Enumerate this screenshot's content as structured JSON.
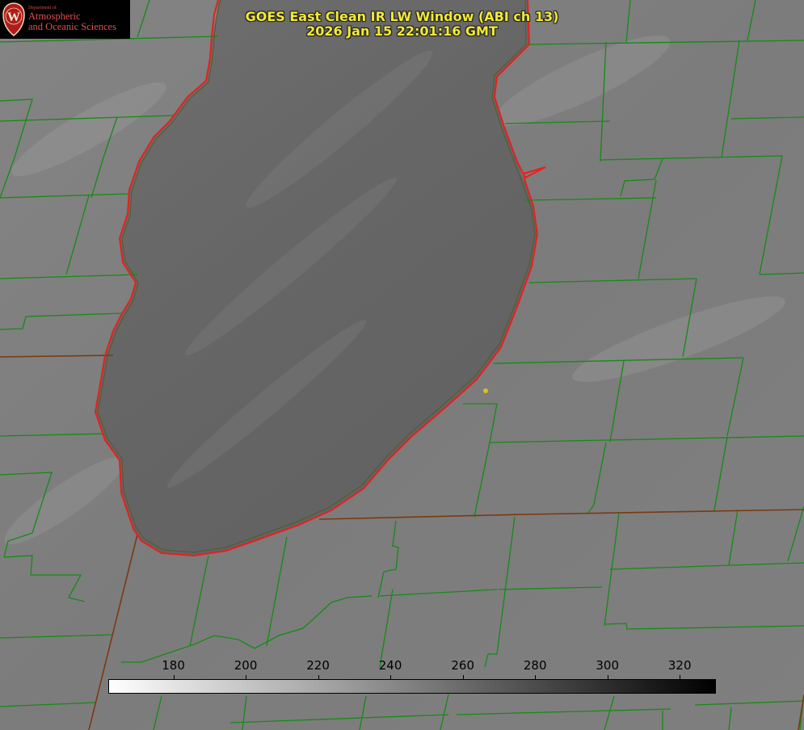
{
  "title": {
    "line1": "GOES East Clean IR LW Window (ABI ch 13)",
    "line2": "2026 Jan 15 22:01:16 GMT"
  },
  "logo": {
    "dept": "Department of",
    "line1": "Atmospheric",
    "line2": "and Oceanic Sciences",
    "seal_letter": "W"
  },
  "colorbar": {
    "ticks": [
      "180",
      "200",
      "220",
      "240",
      "260",
      "280",
      "300",
      "320"
    ],
    "tick_values": [
      180,
      200,
      220,
      240,
      260,
      280,
      300,
      320
    ],
    "range": [
      162,
      330
    ],
    "color_low": "#ffffff",
    "color_high": "#000000"
  },
  "colors": {
    "title_text": "#f2ea33",
    "county_lines": "#168a16",
    "state_lines": "#7a3a12",
    "coastline": "#ee1c1c",
    "land": "#7d7d7d",
    "lake": "#666666",
    "station_marker": "#d8c21a",
    "logo_text": "#e05050"
  }
}
